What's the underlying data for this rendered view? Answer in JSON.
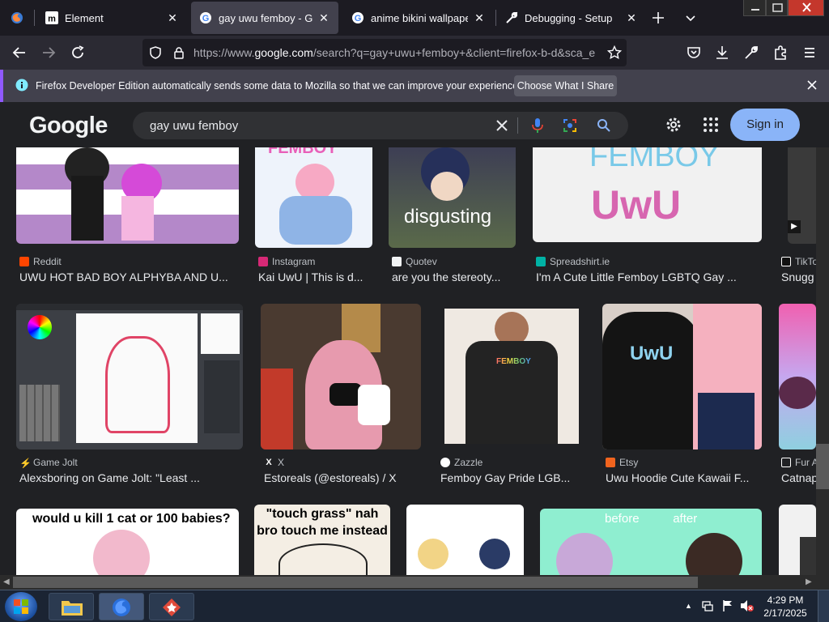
{
  "browser": {
    "tabs": [
      {
        "label": "",
        "favicon": "firefox-icon"
      },
      {
        "label": "Element",
        "favicon": "matrix-icon"
      },
      {
        "label": "gay uwu femboy - Google",
        "favicon": "google-icon",
        "active": true
      },
      {
        "label": "anime bikini wallpaper - ",
        "favicon": "google-icon"
      },
      {
        "label": "Debugging - Setup",
        "favicon": "wrench-icon"
      }
    ],
    "url": {
      "scheme": "https://www.",
      "domain": "google.com",
      "path": "/search?q=gay+uwu+femboy+&client=firefox-b-d&sca_e"
    },
    "notification": {
      "text": "Firefox Developer Edition automatically sends some data to Mozilla so that we can improve your experience.",
      "button": "Choose What I Share"
    }
  },
  "google": {
    "logo": "Google",
    "query": "gay uwu femboy",
    "signin": "Sign in",
    "colors": {
      "signin_bg": "#8ab4f8",
      "bg": "#202124"
    }
  },
  "results": [
    {
      "source": "Reddit",
      "caption": "UWU HOT BAD BOY ALPHYBA AND U...",
      "icon_color": "#ff4500",
      "overlay": ""
    },
    {
      "source": "Instagram",
      "caption": "Kai UwU | This is d...",
      "icon_color": "#d62976",
      "overlay": "FEMBOY"
    },
    {
      "source": "Quotev",
      "caption": "are you the stereoty...",
      "icon_color": "#f1f3f4",
      "overlay": "disgusting"
    },
    {
      "source": "Spreadshirt.ie",
      "caption": "I'm A Cute Little Femboy LGBTQ Gay ...",
      "icon_color": "#00b2a5",
      "overlay": "FEMBOY"
    },
    {
      "source": "TikTo",
      "caption": "Snugg",
      "icon_color": "#ffffff",
      "overlay": ""
    },
    {
      "source": "Game Jolt",
      "caption": "Alexsboring on Game Jolt: \"Least ...",
      "icon_color": "#ccff00",
      "overlay": ""
    },
    {
      "source": "X",
      "caption": "Estoreals (@estoreals) / X",
      "icon_color": "#ffffff",
      "overlay": ""
    },
    {
      "source": "Zazzle",
      "caption": "Femboy Gay Pride LGB...",
      "icon_color": "#ffffff",
      "overlay": "FEMBOY"
    },
    {
      "source": "Etsy",
      "caption": "Uwu Hoodie Cute Kawaii F...",
      "icon_color": "#f1641e",
      "overlay": "UwU"
    },
    {
      "source": "Fur A",
      "caption": "Catnap",
      "icon_color": "#ffffff",
      "overlay": ""
    },
    {
      "source": "",
      "caption": "",
      "icon_color": "",
      "overlay": "would u kill 1 cat or 100 babies?"
    },
    {
      "source": "",
      "caption": "",
      "icon_color": "",
      "overlay": "\"touch grass\" nah bro touch me instead"
    },
    {
      "source": "",
      "caption": "",
      "icon_color": "",
      "overlay": ""
    },
    {
      "source": "",
      "caption": "",
      "icon_color": "",
      "overlay": "before          after"
    }
  ],
  "taskbar": {
    "time": "4:29 PM",
    "date": "2/17/2025"
  }
}
